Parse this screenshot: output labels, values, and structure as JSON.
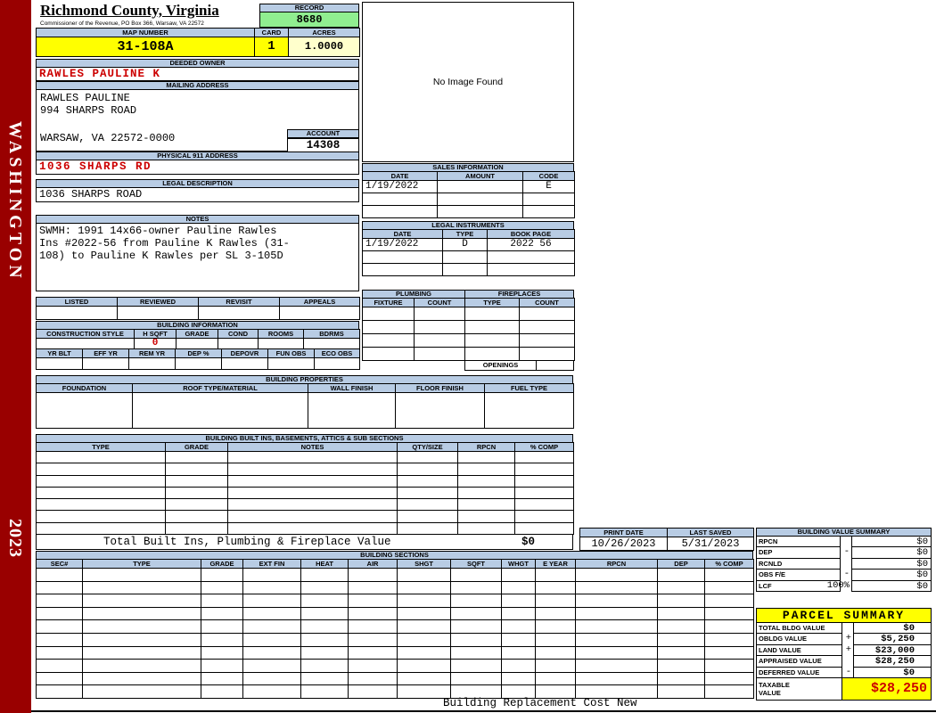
{
  "sidebar": {
    "district": "WASHINGTON",
    "year": "2023"
  },
  "header": {
    "county": "Richmond County, Virginia",
    "office": "Commissioner of the Revenue, PO Box 366, Warsaw, VA 22572",
    "record_label": "RECORD",
    "record_value": "8680",
    "map_label": "MAP NUMBER",
    "map_value": "31-108A",
    "card_label": "CARD",
    "card_value": "1",
    "acres_label": "ACRES",
    "acres_value": "1.0000"
  },
  "owner": {
    "deeded_label": "DEEDED OWNER",
    "deeded_value": "RAWLES PAULINE K",
    "mailing_label": "MAILING ADDRESS",
    "mailing_line1": "RAWLES PAULINE",
    "mailing_line2": "994 SHARPS ROAD",
    "mailing_line3": "WARSAW, VA 22572-0000",
    "account_label": "ACCOUNT",
    "account_value": "14308",
    "physical_label": "PHYSICAL 911 ADDRESS",
    "physical_value": "1036 SHARPS RD",
    "legal_label": "LEGAL DESCRIPTION",
    "legal_value": "1036 SHARPS ROAD",
    "notes_label": "NOTES",
    "notes_line1": "SWMH: 1991 14x66-owner Pauline Rawles",
    "notes_line2": "Ins #2022-56 from Pauline K Rawles (31-",
    "notes_line3": "108) to Pauline K Rawles per SL 3-105D"
  },
  "image_panel": {
    "placeholder": "No Image Found"
  },
  "sales": {
    "title": "SALES INFORMATION",
    "headers": [
      "DATE",
      "AMOUNT",
      "CODE"
    ],
    "row1": {
      "date": "1/19/2022",
      "amount": "",
      "code": "E"
    }
  },
  "legal_instruments": {
    "title": "LEGAL INSTRUMENTS",
    "headers": [
      "DATE",
      "TYPE",
      "BOOK PAGE"
    ],
    "row1": {
      "date": "1/19/2022",
      "type": "D",
      "book_page": "2022 56"
    }
  },
  "plumbing_fireplaces": {
    "plumbing_title": "PLUMBING",
    "fireplaces_title": "FIREPLACES",
    "headers": [
      "FIXTURE",
      "COUNT",
      "TYPE",
      "COUNT"
    ],
    "openings_label": "OPENINGS"
  },
  "inspection": {
    "headers": [
      "LISTED",
      "REVIEWED",
      "REVISIT",
      "APPEALS"
    ]
  },
  "building_information": {
    "title": "BUILDING INFORMATION",
    "headers1": [
      "CONSTRUCTION STYLE",
      "H SQFT",
      "GRADE",
      "COND",
      "ROOMS",
      "BDRMS"
    ],
    "h_sqft": "0",
    "headers2": [
      "YR BLT",
      "EFF YR",
      "REM YR",
      "DEP %",
      "DEPOVR",
      "FUN OBS",
      "ECO OBS"
    ]
  },
  "building_properties": {
    "title": "BUILDING PROPERTIES",
    "headers": [
      "FOUNDATION",
      "ROOF TYPE/MATERIAL",
      "WALL FINISH",
      "FLOOR FINISH",
      "FUEL TYPE"
    ]
  },
  "built_ins": {
    "title": "BUILDING BUILT INS, BASEMENTS, ATTICS & SUB SECTIONS",
    "headers": [
      "TYPE",
      "GRADE",
      "NOTES",
      "QTY/SIZE",
      "RPCN",
      "% COMP"
    ],
    "total_label": "Total Built Ins, Plumbing & Fireplace Value",
    "total_value": "$0"
  },
  "dates": {
    "print_label": "PRINT DATE",
    "print_value": "10/26/2023",
    "saved_label": "LAST SAVED",
    "saved_value": "5/31/2023"
  },
  "building_value_summary": {
    "title": "BUILDING VALUE SUMMARY",
    "rows": [
      {
        "label": "RPCN",
        "op": "",
        "value": "$0"
      },
      {
        "label": "DEP",
        "op": "-",
        "value": "$0"
      },
      {
        "label": "RCNLD",
        "op": "",
        "value": "$0"
      },
      {
        "label": "OBS F/E",
        "op": "-",
        "value": "$0"
      },
      {
        "label": "LCF",
        "op": "100%",
        "value": "$0"
      }
    ]
  },
  "building_sections": {
    "title": "BUILDING SECTIONS",
    "headers": [
      "SEC#",
      "TYPE",
      "GRADE",
      "EXT FIN",
      "HEAT",
      "AIR",
      "SHGT",
      "SQFT",
      "WHGT",
      "E YEAR",
      "RPCN",
      "DEP",
      "% COMP"
    ]
  },
  "parcel_summary": {
    "title": "PARCEL SUMMARY",
    "rows": [
      {
        "label": "TOTAL BLDG VALUE",
        "op": "",
        "value": "$0"
      },
      {
        "label": "OBLDG VALUE",
        "op": "+",
        "value": "$5,250"
      },
      {
        "label": "LAND VALUE",
        "op": "+",
        "value": "$23,000"
      },
      {
        "label": "APPRAISED VALUE",
        "op": "",
        "value": "$28,250"
      },
      {
        "label": "DEFERRED VALUE",
        "op": "-",
        "value": "$0"
      }
    ],
    "taxable_label_line1": "TAXABLE",
    "taxable_label_line2": "VALUE",
    "taxable_value": "$28,250"
  },
  "footer": {
    "note": "Building Replacement Cost New"
  },
  "colors": {
    "sidebar_red": "#990000",
    "header_bar_blue": "#B8CCE4",
    "highlight_yellow": "#FFFF00",
    "record_green": "#90EE90",
    "acres_cream": "#FFFFCC",
    "alert_red_text": "#CC0000"
  }
}
